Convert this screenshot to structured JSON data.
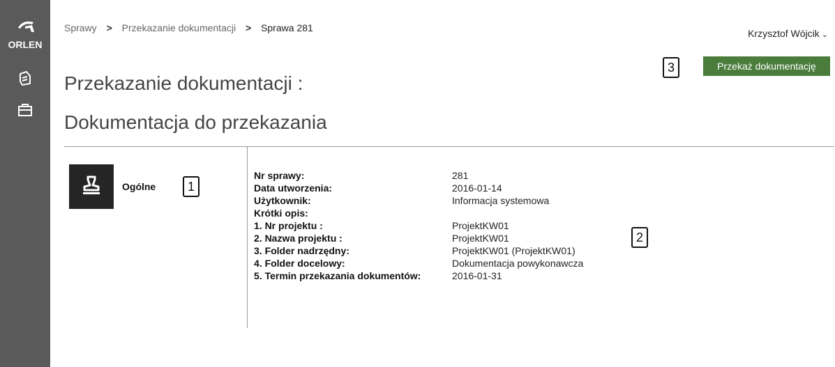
{
  "brand": {
    "logo_text": "ORLEN"
  },
  "sidebar": {
    "items": [
      {
        "icon": "documents-icon"
      },
      {
        "icon": "briefcase-icon"
      }
    ]
  },
  "breadcrumb": {
    "items": [
      "Sprawy",
      "Przekazanie dokumentacji",
      "Sprawa 281"
    ],
    "separator": ">"
  },
  "user": {
    "name": "Krzysztof Wójcik"
  },
  "header": {
    "title": "Przekazanie dokumentacji :",
    "subtitle": "Dokumentacja do przekazania",
    "action_button": "Przekaż dokumentację"
  },
  "markers": [
    "1",
    "2",
    "3"
  ],
  "section": {
    "label": "Ogólne",
    "icon": "stamp-icon"
  },
  "details": [
    {
      "label": "Nr sprawy:",
      "value": "281"
    },
    {
      "label": "Data utworzenia:",
      "value": "2016-01-14"
    },
    {
      "label": "Użytkownik:",
      "value": "Informacja systemowa"
    },
    {
      "label": "Krótki opis:",
      "value": ""
    },
    {
      "label": "1. Nr projektu :",
      "value": "ProjektKW01"
    },
    {
      "label": "2. Nazwa projektu :",
      "value": "ProjektKW01"
    },
    {
      "label": "3. Folder nadrzędny:",
      "value": "ProjektKW01 (ProjektKW01)"
    },
    {
      "label": "4. Folder docelowy:",
      "value": "Dokumentacja powykonawcza"
    },
    {
      "label": "5. Termin przekazania dokumentów:",
      "value": "2016-01-31"
    }
  ],
  "colors": {
    "sidebar": "#5a5a5a",
    "button": "#4a7c3c",
    "tile": "#252525"
  }
}
